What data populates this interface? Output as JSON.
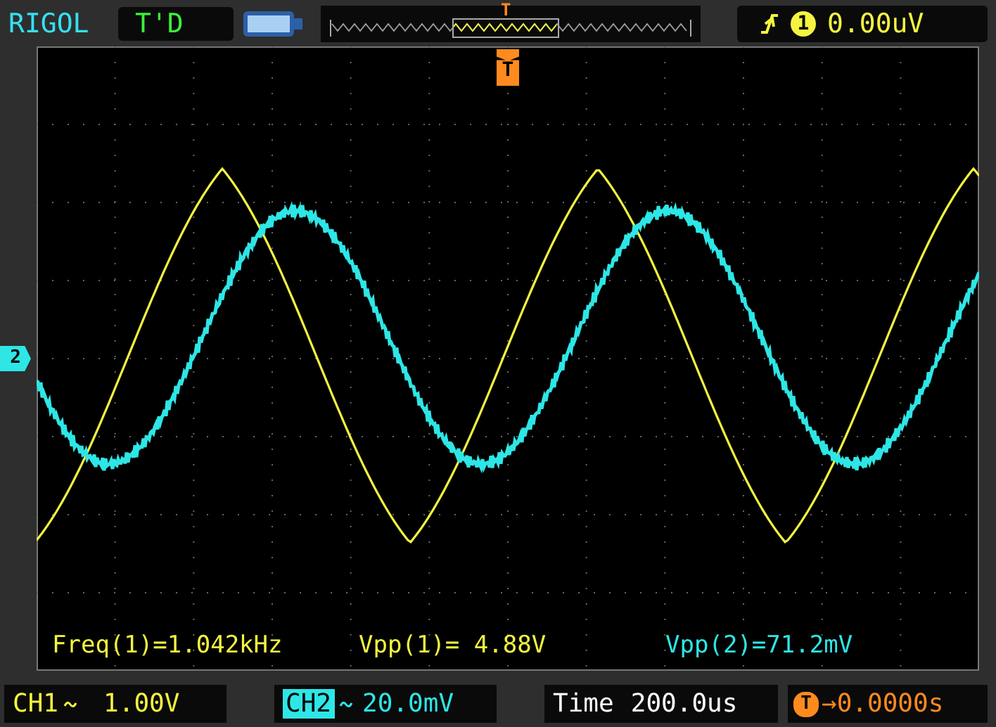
{
  "header": {
    "brand": "RIGOL",
    "status": "T'D",
    "overview_marker": "T",
    "trigger_source": "1",
    "trigger_level": "0.00uV"
  },
  "screen": {
    "trigger_marker": "T",
    "channel_marker": "2",
    "measurements": [
      {
        "text": "Freq(1)=1.042kHz",
        "color": "#f4f440"
      },
      {
        "text": "Vpp(1)= 4.88V",
        "color": "#f4f440"
      },
      {
        "text": "Vpp(2)=71.2mV",
        "color": "#2ee6e6"
      }
    ]
  },
  "channels": [
    {
      "name": "CH1",
      "scale": "1.00V",
      "color": "#f4f440",
      "selected": false
    },
    {
      "name": "CH2",
      "scale": "20.0mV",
      "color": "#2ee6e6",
      "selected": true
    }
  ],
  "timebase": {
    "label": "Time",
    "value": "200.0us"
  },
  "trigger_offset": {
    "marker": "T",
    "value": "→0.0000s"
  }
}
